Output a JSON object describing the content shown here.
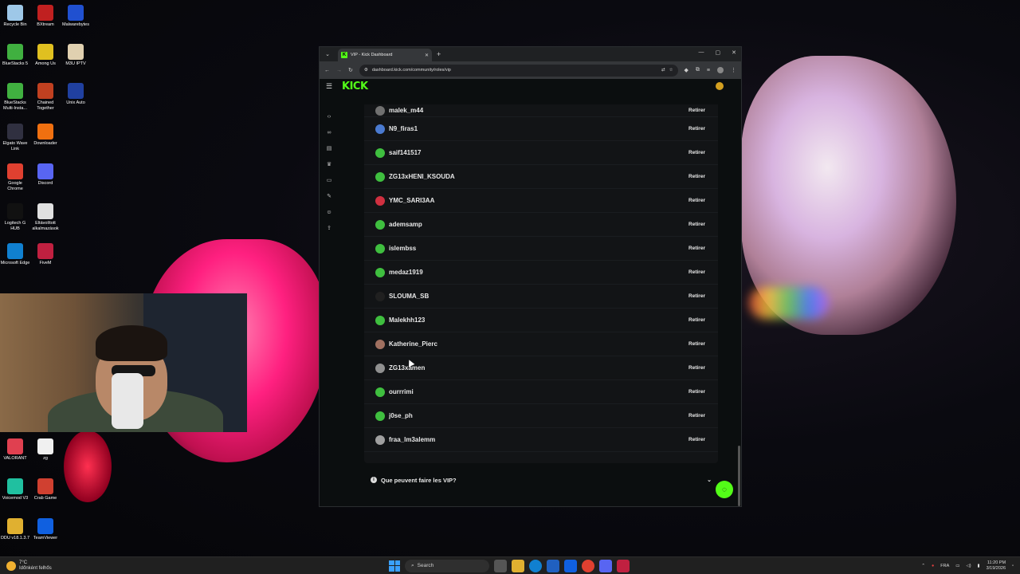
{
  "desktop": {
    "icons": [
      {
        "label": "Recycle Bin",
        "color": "#9ec8e8"
      },
      {
        "label": "BXtream",
        "color": "#c02020"
      },
      {
        "label": "Malwarebytes",
        "color": "#2050d0"
      },
      {
        "label": "BlueStacks 5",
        "color": "#40b040"
      },
      {
        "label": "Among Us",
        "color": "#e0c020"
      },
      {
        "label": "M3U IPTV",
        "color": "#e0d0b0"
      },
      {
        "label": "BlueStacks Multi-Insta...",
        "color": "#40b040"
      },
      {
        "label": "Chained Together",
        "color": "#c04020"
      },
      {
        "label": "Unix Auto",
        "color": "#2040a0"
      },
      {
        "label": "Elgato Wave Link",
        "color": "#303040"
      },
      {
        "label": "Downloader",
        "color": "#f07010"
      },
      {
        "label": "Google Chrome",
        "color": "#e04030"
      },
      {
        "label": "Discord",
        "color": "#5865f2"
      },
      {
        "label": "Logitech G HUB",
        "color": "#111111"
      },
      {
        "label": "Eltávolított alkalmazások",
        "color": "#e0e0e0"
      },
      {
        "label": "Microsoft Edge",
        "color": "#1080d0"
      },
      {
        "label": "FiveM",
        "color": "#c02040"
      },
      {
        "label": "VALORANT",
        "color": "#e04050"
      },
      {
        "label": "zg",
        "color": "#f0f0f0"
      },
      {
        "label": "Voicemod V3",
        "color": "#20c0a0"
      },
      {
        "label": "Crab Game",
        "color": "#d04030"
      },
      {
        "label": "DDU v18.1.3.7",
        "color": "#e0b030"
      },
      {
        "label": "TeamViewer",
        "color": "#1060e0"
      }
    ]
  },
  "browser": {
    "tab_title": "VIP - Kick Dashboard",
    "url": "dashboard.kick.com/community/roles/vip",
    "logo": "KICK"
  },
  "vip_list": [
    {
      "name": "malek_m44",
      "action": "Retirer",
      "avatar_color": "#707070"
    },
    {
      "name": "N9_firas1",
      "action": "Retirer",
      "avatar_color": "#4a7ad0"
    },
    {
      "name": "saif141517",
      "action": "Retirer",
      "avatar_color": "#3fbf3f"
    },
    {
      "name": "ZG13xHENI_KSOUDA",
      "action": "Retirer",
      "avatar_color": "#3fbf3f"
    },
    {
      "name": "YMC_SARI3AA",
      "action": "Retirer",
      "avatar_color": "#d03040"
    },
    {
      "name": "ademsamp",
      "action": "Retirer",
      "avatar_color": "#3fbf3f"
    },
    {
      "name": "islembss",
      "action": "Retirer",
      "avatar_color": "#3fbf3f"
    },
    {
      "name": "medaz1919",
      "action": "Retirer",
      "avatar_color": "#3fbf3f"
    },
    {
      "name": "SLOUMA_SB",
      "action": "Retirer",
      "avatar_color": "#202020"
    },
    {
      "name": "Malekhh123",
      "action": "Retirer",
      "avatar_color": "#3fbf3f"
    },
    {
      "name": "Katherine_Pierc",
      "action": "Retirer",
      "avatar_color": "#a07060"
    },
    {
      "name": "ZG13xamen",
      "action": "Retirer",
      "avatar_color": "#909090"
    },
    {
      "name": "ourrrimi",
      "action": "Retirer",
      "avatar_color": "#3fbf3f"
    },
    {
      "name": "j0se_ph",
      "action": "Retirer",
      "avatar_color": "#3fbf3f"
    },
    {
      "name": "fraa_lm3alemm",
      "action": "Retirer",
      "avatar_color": "#a0a0a0"
    }
  ],
  "faq": {
    "question": "Que peuvent faire les VIP?"
  },
  "taskbar": {
    "weather_temp": "7°C",
    "weather_desc": "Időnként felhős",
    "search_placeholder": "Search",
    "lang": "FRA",
    "time": "11:20 PM",
    "date": "3/19/2026"
  },
  "colors": {
    "accent": "#53fc18"
  }
}
